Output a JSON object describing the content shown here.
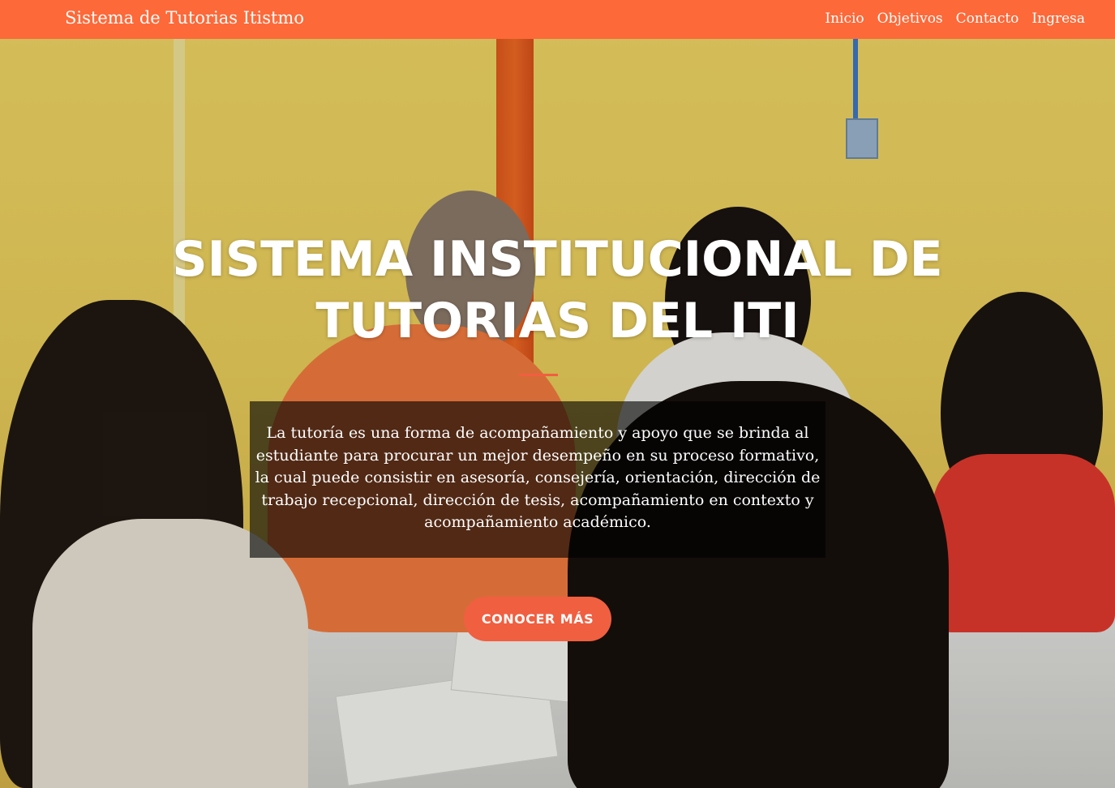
{
  "navbar": {
    "brand": "Sistema de Tutorias Itistmo",
    "links": [
      {
        "label": "Inicio"
      },
      {
        "label": "Objetivos"
      },
      {
        "label": "Contacto"
      },
      {
        "label": "Ingresa"
      }
    ]
  },
  "hero": {
    "title": "SISTEMA INSTITUCIONAL DE TUTORIAS DEL ITI",
    "intro": "La tutoría es una forma de acompañamiento y apoyo que se brinda al estudiante para procurar un mejor desempeño en su proceso formativo, la cual puede consistir en asesoría, consejería, orientación, dirección de trabajo recepcional, dirección de tesis, acompañamiento en contexto y acompañamiento académico.",
    "cta_label": "CONOCER MÁS"
  },
  "colors": {
    "navbar_bg": "#fd6939",
    "accent": "#f05f40",
    "hero_text": "#ffffff"
  }
}
